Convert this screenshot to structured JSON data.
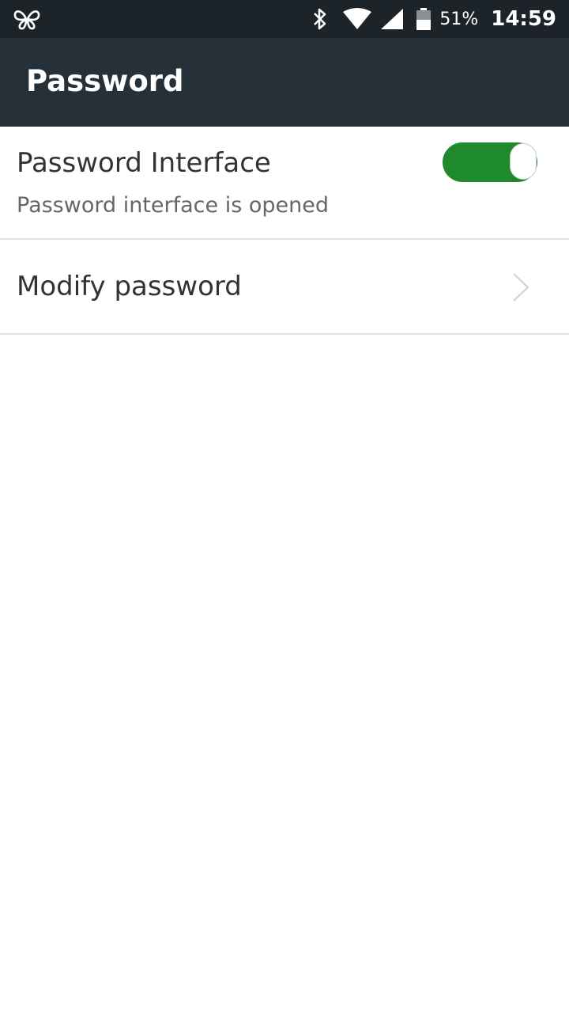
{
  "status_bar": {
    "battery_percent": "51%",
    "time": "14:59",
    "icons": [
      "butterfly-icon",
      "bluetooth-icon",
      "wifi-icon",
      "signal-icon",
      "battery-icon"
    ]
  },
  "app_bar": {
    "title": "Password"
  },
  "password_interface": {
    "title": "Password Interface",
    "subtitle": "Password interface is opened",
    "enabled": true,
    "toggle_color": "#1f8a2c"
  },
  "modify_password": {
    "label": "Modify password",
    "icon": "chevron-right-icon"
  },
  "colors": {
    "status_bar": "#1c2329",
    "app_bar": "#263038",
    "divider": "#e3e3e3"
  }
}
